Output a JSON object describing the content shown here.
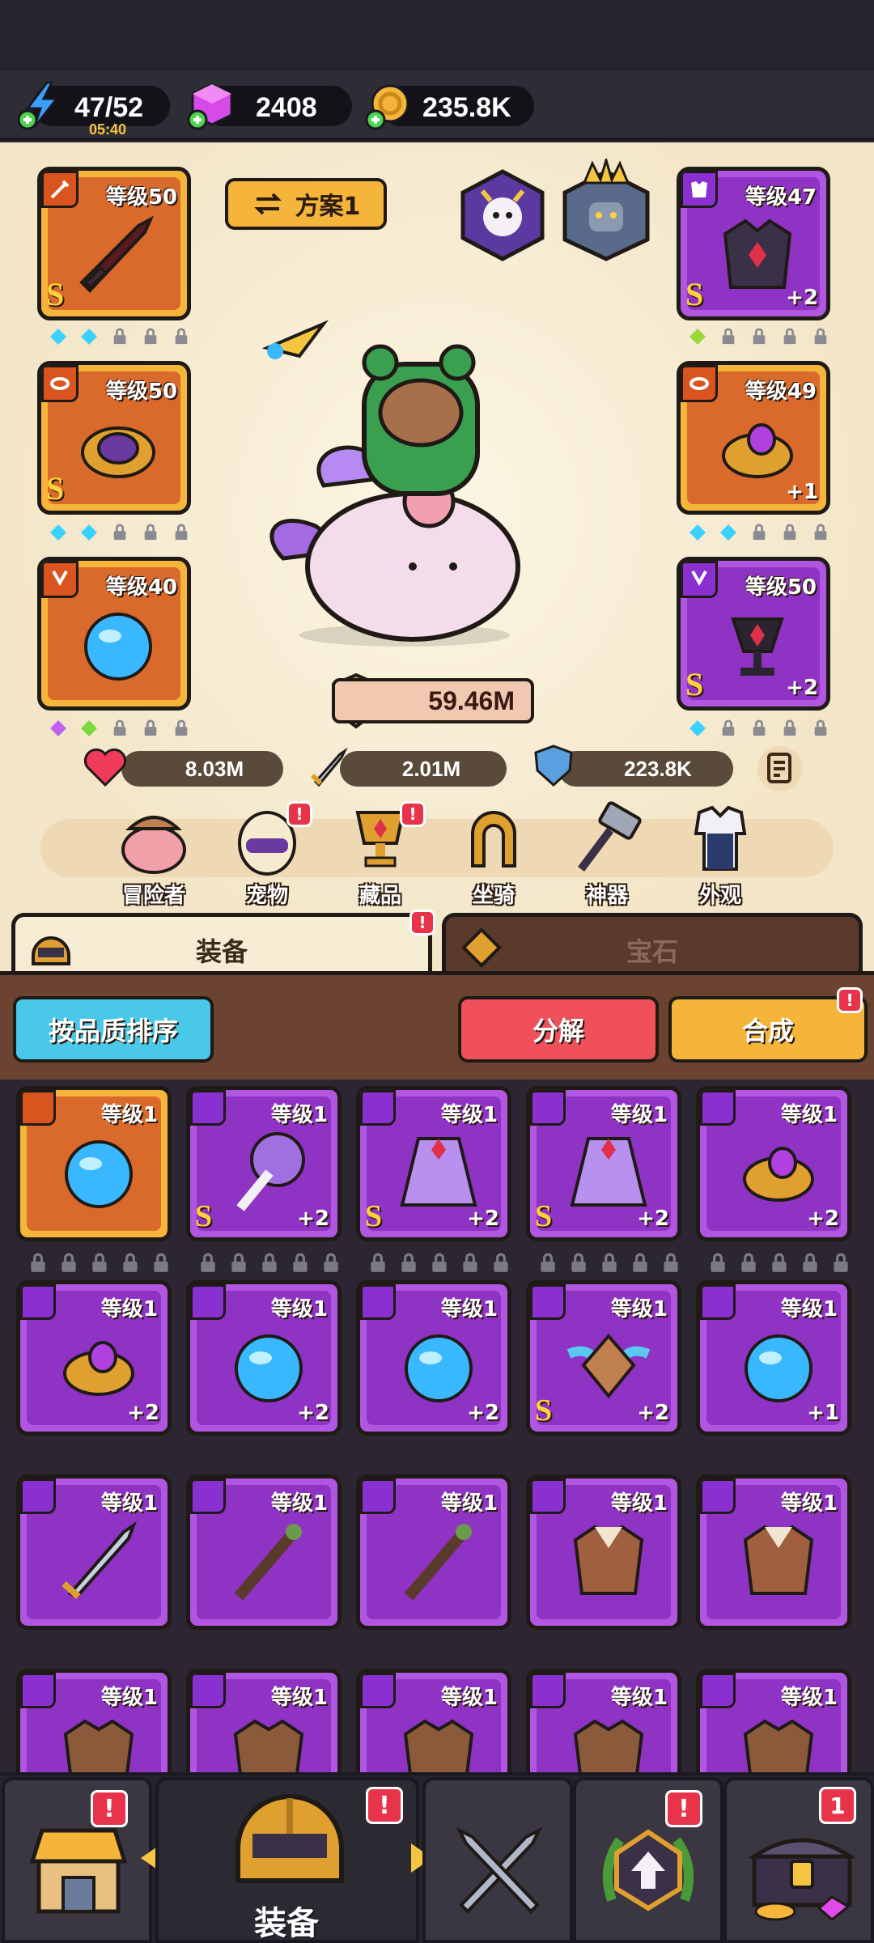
{
  "resources": {
    "energy": "47/52",
    "energy_timer": "05:40",
    "gems": "2408",
    "gold": "235.8K"
  },
  "plan_button": "方案1",
  "equipped": {
    "weapon": {
      "level": "等级50",
      "quality": "S"
    },
    "necklace_ring": {
      "level": "等级50",
      "quality": "S"
    },
    "orb": {
      "level": "等级40"
    },
    "armor": {
      "level": "等级47",
      "quality": "S",
      "plus": "+2"
    },
    "ring": {
      "level": "等级49",
      "plus": "+1"
    },
    "chalice": {
      "level": "等级50",
      "quality": "S",
      "plus": "+2"
    }
  },
  "power": "59.46M",
  "stats": {
    "hp": "8.03M",
    "atk": "2.01M",
    "def": "223.8K"
  },
  "categories": [
    "冒险者",
    "宠物",
    "藏品",
    "坐骑",
    "神器",
    "外观"
  ],
  "tabs": {
    "equipment": "装备",
    "gems": "宝石"
  },
  "toolbar": {
    "sort": "按品质排序",
    "dismantle": "分解",
    "merge": "合成"
  },
  "inventory": [
    {
      "level": "等级1",
      "quality": "",
      "plus": ""
    },
    {
      "level": "等级1",
      "quality": "S",
      "plus": "+2"
    },
    {
      "level": "等级1",
      "quality": "S",
      "plus": "+2"
    },
    {
      "level": "等级1",
      "quality": "S",
      "plus": "+2"
    },
    {
      "level": "等级1",
      "quality": "",
      "plus": "+2"
    },
    {
      "level": "等级1",
      "quality": "",
      "plus": "+2"
    },
    {
      "level": "等级1",
      "quality": "",
      "plus": "+2"
    },
    {
      "level": "等级1",
      "quality": "",
      "plus": "+2"
    },
    {
      "level": "等级1",
      "quality": "S",
      "plus": "+2"
    },
    {
      "level": "等级1",
      "quality": "",
      "plus": "+1"
    },
    {
      "level": "等级1",
      "quality": "",
      "plus": ""
    },
    {
      "level": "等级1",
      "quality": "",
      "plus": ""
    },
    {
      "level": "等级1",
      "quality": "",
      "plus": ""
    },
    {
      "level": "等级1",
      "quality": "",
      "plus": ""
    },
    {
      "level": "等级1",
      "quality": "",
      "plus": ""
    },
    {
      "level": "等级1",
      "quality": "",
      "plus": ""
    },
    {
      "level": "等级1",
      "quality": "",
      "plus": ""
    },
    {
      "level": "等级1",
      "quality": "",
      "plus": ""
    },
    {
      "level": "等级1",
      "quality": "",
      "plus": ""
    },
    {
      "level": "等级1",
      "quality": "",
      "plus": ""
    }
  ],
  "nav": {
    "active_label": "装备",
    "chest_badge": "1",
    "alert": "!"
  }
}
